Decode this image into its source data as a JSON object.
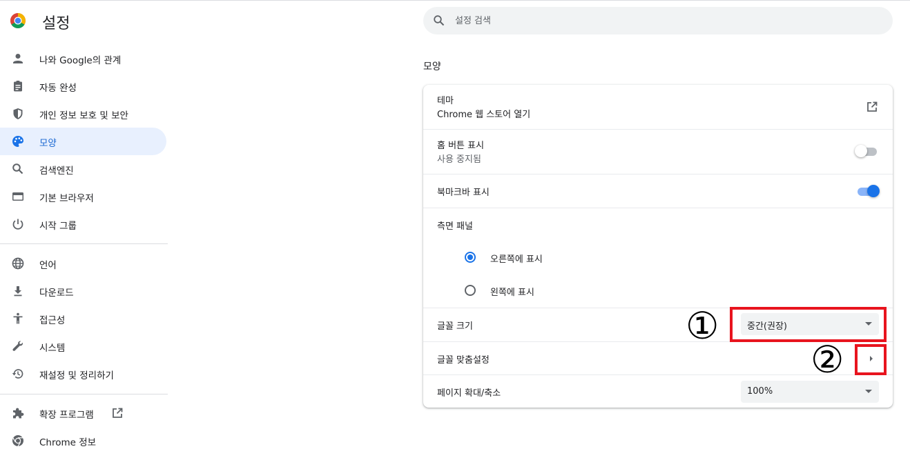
{
  "header": {
    "title": "설정"
  },
  "search": {
    "placeholder": "설정 검색"
  },
  "sidebar": {
    "items": [
      {
        "label": "나와 Google의 관계",
        "icon": "person-icon"
      },
      {
        "label": "자동 완성",
        "icon": "clipboard-icon"
      },
      {
        "label": "개인 정보 보호 및 보안",
        "icon": "shield-icon"
      },
      {
        "label": "모양",
        "icon": "palette-icon",
        "active": true
      },
      {
        "label": "검색엔진",
        "icon": "search-icon"
      },
      {
        "label": "기본 브라우저",
        "icon": "browser-icon"
      },
      {
        "label": "시작 그룹",
        "icon": "power-icon"
      },
      {
        "label": "언어",
        "icon": "globe-icon"
      },
      {
        "label": "다운로드",
        "icon": "download-icon"
      },
      {
        "label": "접근성",
        "icon": "accessibility-icon"
      },
      {
        "label": "시스템",
        "icon": "wrench-icon"
      },
      {
        "label": "재설정 및 정리하기",
        "icon": "restore-icon"
      },
      {
        "label": "확장 프로그램",
        "icon": "puzzle-icon"
      },
      {
        "label": "Chrome 정보",
        "icon": "chrome-icon"
      }
    ]
  },
  "main": {
    "section_title": "모양",
    "theme": {
      "title": "테마",
      "subtitle": "Chrome 웹 스토어 열기"
    },
    "home_button": {
      "title": "홈 버튼 표시",
      "subtitle": "사용 중지됨",
      "enabled": false
    },
    "bookmarks_bar": {
      "title": "북마크바 표시",
      "enabled": true
    },
    "side_panel": {
      "title": "측면 패널",
      "options": [
        {
          "label": "오른쪽에 표시",
          "checked": true
        },
        {
          "label": "왼쪽에 표시",
          "checked": false
        }
      ]
    },
    "font_size": {
      "title": "글꼴 크기",
      "value": "중간(권장)"
    },
    "customize_fonts": {
      "title": "글꼴 맞춤설정"
    },
    "page_zoom": {
      "title": "페이지 확대/축소",
      "value": "100%"
    }
  },
  "annotations": {
    "marker_1": "①",
    "marker_2": "②",
    "color": "#e8141e"
  },
  "colors": {
    "accent": "#1a73e8",
    "active_bg": "#e8f0fe",
    "active_text": "#1967d2"
  }
}
